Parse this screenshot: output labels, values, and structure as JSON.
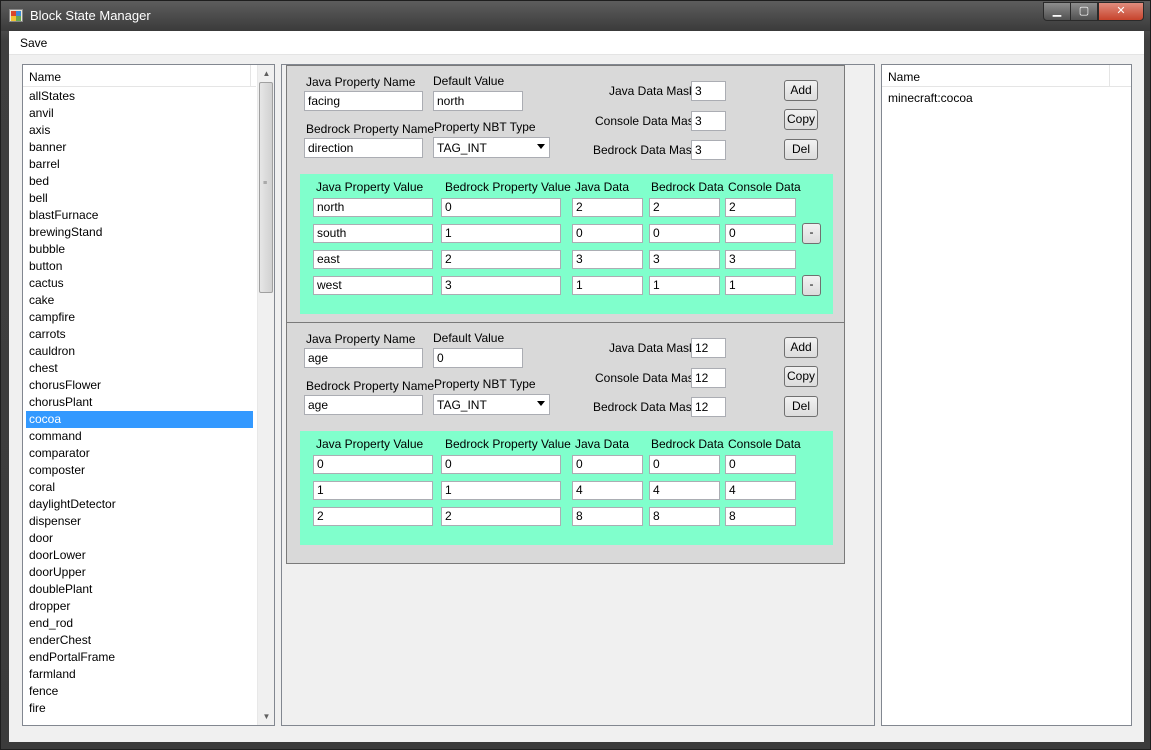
{
  "window": {
    "title": "Block State Manager",
    "controls": {
      "minimize": "▁",
      "maximize": "▢",
      "close": "✕"
    }
  },
  "menu": {
    "save": "Save"
  },
  "left_list": {
    "header": "Name",
    "selected": "cocoa",
    "items": [
      "allStates",
      "anvil",
      "axis",
      "banner",
      "barrel",
      "bed",
      "bell",
      "blastFurnace",
      "brewingStand",
      "bubble",
      "button",
      "cactus",
      "cake",
      "campfire",
      "carrots",
      "cauldron",
      "chest",
      "chorusFlower",
      "chorusPlant",
      "cocoa",
      "command",
      "comparator",
      "composter",
      "coral",
      "daylightDetector",
      "dispenser",
      "door",
      "doorLower",
      "doorUpper",
      "doublePlant",
      "dropper",
      "end_rod",
      "enderChest",
      "endPortalFrame",
      "farmland",
      "fence",
      "fire"
    ],
    "scroll_arrows": {
      "up": "▲",
      "down": "▼"
    }
  },
  "labels": {
    "java_property_name": "Java Property Name",
    "default_value": "Default Value",
    "bedrock_property_name": "Bedrock Property Name",
    "property_nbt_type": "Property NBT Type",
    "java_data_mask": "Java Data Mask",
    "console_data_mask": "Console Data Mask",
    "bedrock_data_mask": "Bedrock Data Mask",
    "add": "Add",
    "copy": "Copy",
    "del": "Del",
    "remove_row": "-",
    "col_java_value": "Java Property Value",
    "col_bedrock_value": "Bedrock Property Value",
    "col_java_data": "Java Data",
    "col_bedrock_data": "Bedrock Data",
    "col_console_data": "Console Data"
  },
  "groups": [
    {
      "java_property_name": "facing",
      "default_value": "north",
      "bedrock_property_name": "direction",
      "nbt_type": "TAG_INT",
      "java_data_mask": "3",
      "console_data_mask": "3",
      "bedrock_data_mask": "3",
      "rows": [
        [
          "north",
          "0",
          "2",
          "2",
          "2"
        ],
        [
          "south",
          "1",
          "0",
          "0",
          "0"
        ],
        [
          "east",
          "2",
          "3",
          "3",
          "3"
        ],
        [
          "west",
          "3",
          "1",
          "1",
          "1"
        ]
      ]
    },
    {
      "java_property_name": "age",
      "default_value": "0",
      "bedrock_property_name": "age",
      "nbt_type": "TAG_INT",
      "java_data_mask": "12",
      "console_data_mask": "12",
      "bedrock_data_mask": "12",
      "rows": [
        [
          "0",
          "0",
          "0",
          "0",
          "0"
        ],
        [
          "1",
          "1",
          "4",
          "4",
          "4"
        ],
        [
          "2",
          "2",
          "8",
          "8",
          "8"
        ]
      ]
    }
  ],
  "right_list": {
    "header": "Name",
    "items": [
      "minecraft:cocoa"
    ]
  }
}
